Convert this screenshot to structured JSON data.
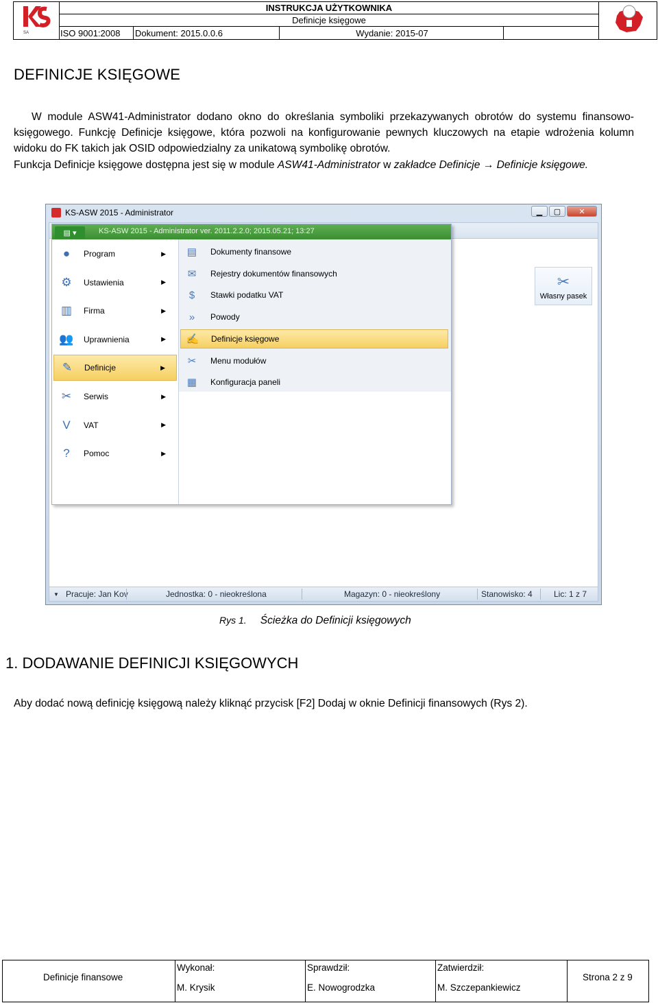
{
  "header": {
    "title_line1": "INSTRUKCJA UŻYTKOWNIKA",
    "title_line2": "Definicje księgowe",
    "iso": "ISO 9001:2008",
    "document": "Dokument: 2015.0.0.6",
    "edition": "Wydanie: 2015-07",
    "logo_left_text": "KS",
    "logo_left_sub": "SA"
  },
  "page_title": "DEFINICJE KSIĘGOWE",
  "intro": {
    "p1_a": "W module ASW41-Administrator dodano okno do określania symboliki przekazywanych obrotów do systemu finansowo-księgowego. Funkcję Definicje księgowe, która pozwoli na konfigurowanie pewnych kluczowych na etapie wdrożenia kolumn widoku do FK takich jak OSID odpowiedzialny za unikatową symbolikę obrotów.",
    "p2_a": "Funkcja Definicje księgowe dostępna jest się w module ",
    "p2_module": "ASW41-Administrator",
    "p2_b": " w ",
    "p2_path": "zakładce Definicje → Definicje księgowe."
  },
  "screenshot": {
    "window_title": "KS-ASW 2015 - Administrator",
    "tab_info": "KS-ASW 2015 - Administrator ver. 2011.2.2.0; 2015.05.21; 13:27",
    "right_button": "Własny pasek",
    "main_menu": [
      {
        "label": "Program",
        "icon": "program-icon",
        "glyph": "●"
      },
      {
        "label": "Ustawienia",
        "icon": "settings-gear-icon",
        "glyph": "⚙"
      },
      {
        "label": "Firma",
        "icon": "company-building-icon",
        "glyph": "▥"
      },
      {
        "label": "Uprawnienia",
        "icon": "users-permissions-icon",
        "glyph": "👥"
      },
      {
        "label": "Definicje",
        "icon": "definitions-icon",
        "glyph": "✎"
      },
      {
        "label": "Serwis",
        "icon": "service-tools-icon",
        "glyph": "✂"
      },
      {
        "label": "VAT",
        "icon": "vat-icon",
        "glyph": "V"
      },
      {
        "label": "Pomoc",
        "icon": "help-icon",
        "glyph": "?"
      }
    ],
    "submenu": [
      {
        "label": "Dokumenty finansowe",
        "icon": "financial-documents-icon",
        "glyph": "▤"
      },
      {
        "label": "Rejestry dokumentów finansowych",
        "icon": "document-registers-icon",
        "glyph": "✉"
      },
      {
        "label": "Stawki podatku VAT",
        "icon": "vat-rates-coins-icon",
        "glyph": "$"
      },
      {
        "label": "Powody",
        "icon": "reasons-arrows-icon",
        "glyph": "»"
      },
      {
        "label": "Definicje księgowe",
        "icon": "accounting-definitions-icon",
        "glyph": "✍"
      },
      {
        "label": "Menu modułów",
        "icon": "module-menu-icon",
        "glyph": "✂"
      },
      {
        "label": "Konfiguracja paneli",
        "icon": "panel-config-icon",
        "glyph": "▦"
      }
    ],
    "status": {
      "user": "Pracuje: Jan Kov",
      "unit": "Jednostka: 0 - nieokreślona",
      "warehouse": "Magazyn: 0 - nieokreślony",
      "station": "Stanowisko: 4",
      "licenses": "Lic: 1 z 7"
    }
  },
  "caption": {
    "number": "Rys 1.",
    "text": "Ścieżka do Definicji księgowych"
  },
  "section1": {
    "heading": "1.  DODAWANIE DEFINICJI KSIĘGOWYCH",
    "text": "Aby dodać nową definicję księgową należy kliknąć przycisk [F2] Dodaj w oknie Definicji finansowych (Rys 2)."
  },
  "footer": {
    "doc_name": "Definicje finansowe",
    "made_label": "Wykonał:",
    "made_value": "M. Krysik",
    "checked_label": "Sprawdził:",
    "checked_value": "E. Nowogrodzka",
    "approved_label": "Zatwierdził:",
    "approved_value": "M. Szczepankiewicz",
    "page": "Strona 2 z 9"
  },
  "colors": {
    "ks_red": "#d31f26",
    "menu_green": "#3a8f31",
    "highlight": "#f6cf62"
  }
}
